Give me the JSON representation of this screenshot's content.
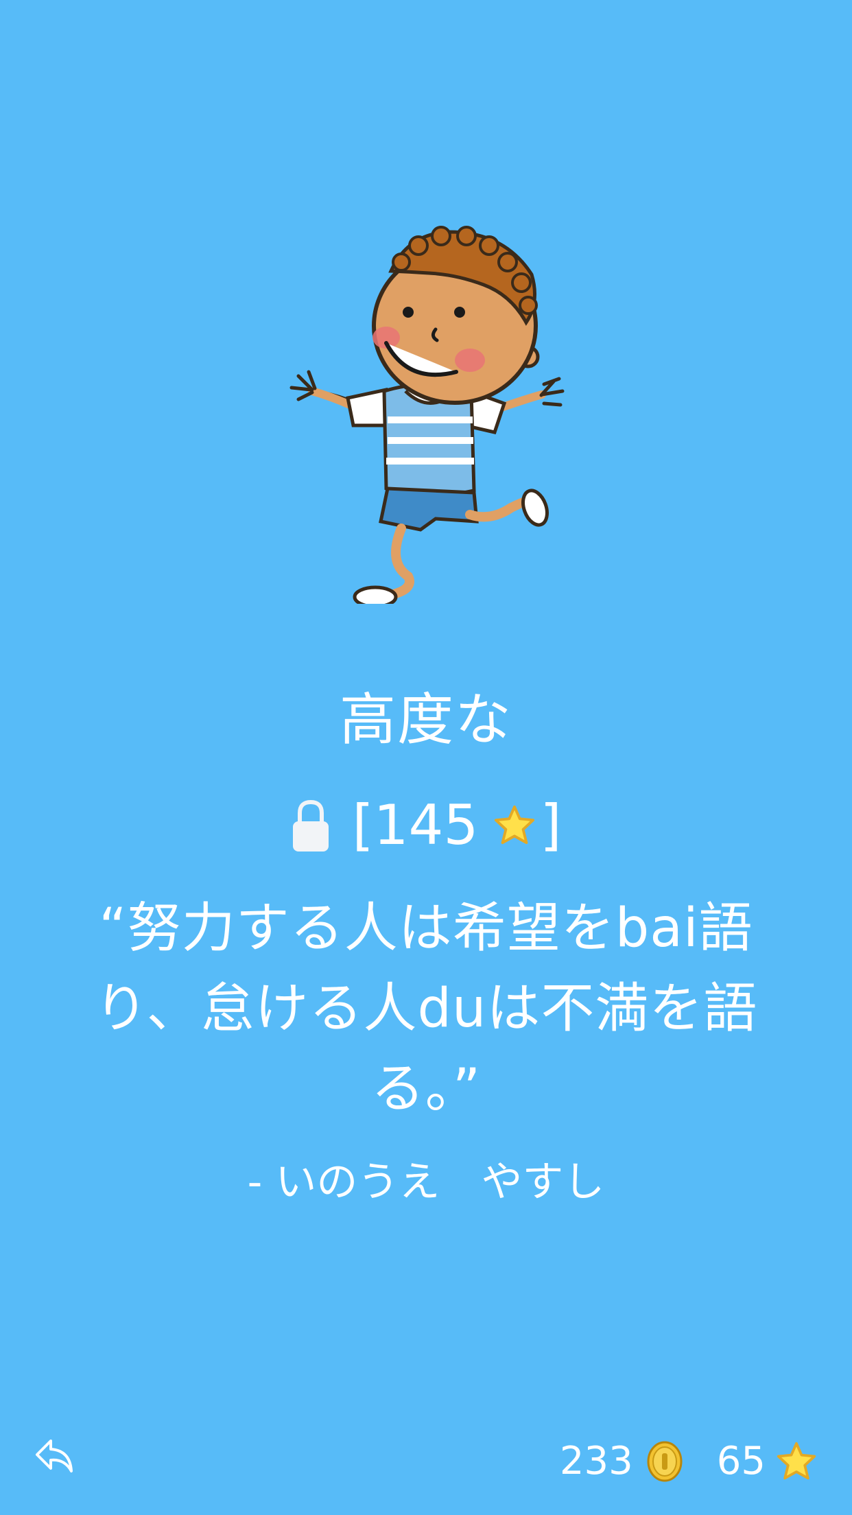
{
  "level": {
    "title": "高度な",
    "locked": true,
    "requirement_open": "[145",
    "requirement_close": "]",
    "requirement_stars": 145
  },
  "quote": {
    "text": "“努力する人は希望をbai語り、怠ける人duは不満を語る。”",
    "author": "- いのうえ　やすし"
  },
  "footer": {
    "coins": "233",
    "stars": "65"
  },
  "icons": {
    "back": "reply-arrow-icon",
    "lock": "lock-icon",
    "coin": "gold-coin-icon",
    "star": "star-icon"
  },
  "colors": {
    "background": "#57bbf8",
    "text": "#ffffff",
    "star": "#ffe04a",
    "coin": "#f2c230"
  }
}
